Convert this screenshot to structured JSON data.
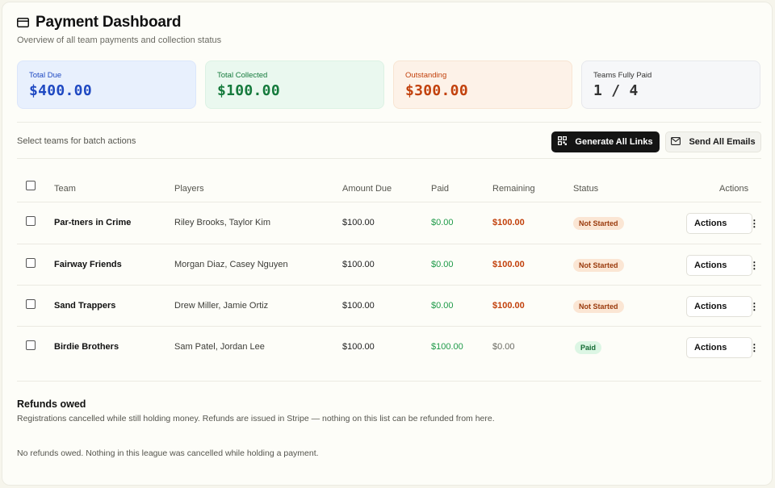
{
  "header": {
    "title": "Payment Dashboard",
    "subtitle": "Overview of all team payments and collection status",
    "icon": "credit-card-icon"
  },
  "stats": [
    {
      "label": "Total Due",
      "value": "$400.00",
      "color": "#1f49c2"
    },
    {
      "label": "Total Collected",
      "value": "$100.00",
      "color": "#157a3c"
    },
    {
      "label": "Outstanding",
      "value": "$300.00",
      "color": "#c2410c"
    },
    {
      "label": "Teams Fully Paid",
      "value": "1 / 4",
      "color": "#333333"
    }
  ],
  "batch": {
    "text": "Select teams for batch actions",
    "generate_label": "Generate All Links",
    "generate_icon": "qr-code-icon",
    "email_label": "Send All Emails",
    "email_icon": "mail-icon"
  },
  "table": {
    "headers": [
      "Team",
      "Players",
      "Amount Due",
      "Paid",
      "Remaining",
      "Status",
      "Actions"
    ],
    "rows": [
      {
        "team": "Par-tners in Crime",
        "players": "Riley Brooks, Taylor Kim",
        "amount_due": "$100.00",
        "paid": "$0.00",
        "remaining": "$100.00",
        "status": "Not Started",
        "action": "Actions"
      },
      {
        "team": "Fairway Friends",
        "players": "Morgan Diaz, Casey Nguyen",
        "amount_due": "$100.00",
        "paid": "$0.00",
        "remaining": "$100.00",
        "status": "Not Started",
        "action": "Actions"
      },
      {
        "team": "Sand Trappers",
        "players": "Drew Miller, Jamie Ortiz",
        "amount_due": "$100.00",
        "paid": "$0.00",
        "remaining": "$100.00",
        "status": "Not Started",
        "action": "Actions"
      },
      {
        "team": "Birdie Brothers",
        "players": "Sam Patel, Jordan Lee",
        "amount_due": "$100.00",
        "paid": "$100.00",
        "remaining": "$0.00",
        "status": "Paid",
        "action": "Actions"
      }
    ]
  },
  "refunds": {
    "title": "Refunds owed",
    "description": "Registrations cancelled while still holding money. Refunds are issued in Stripe — nothing on this list can be refunded from here.",
    "empty": "No refunds owed. Nothing in this league was cancelled while holding a payment."
  }
}
